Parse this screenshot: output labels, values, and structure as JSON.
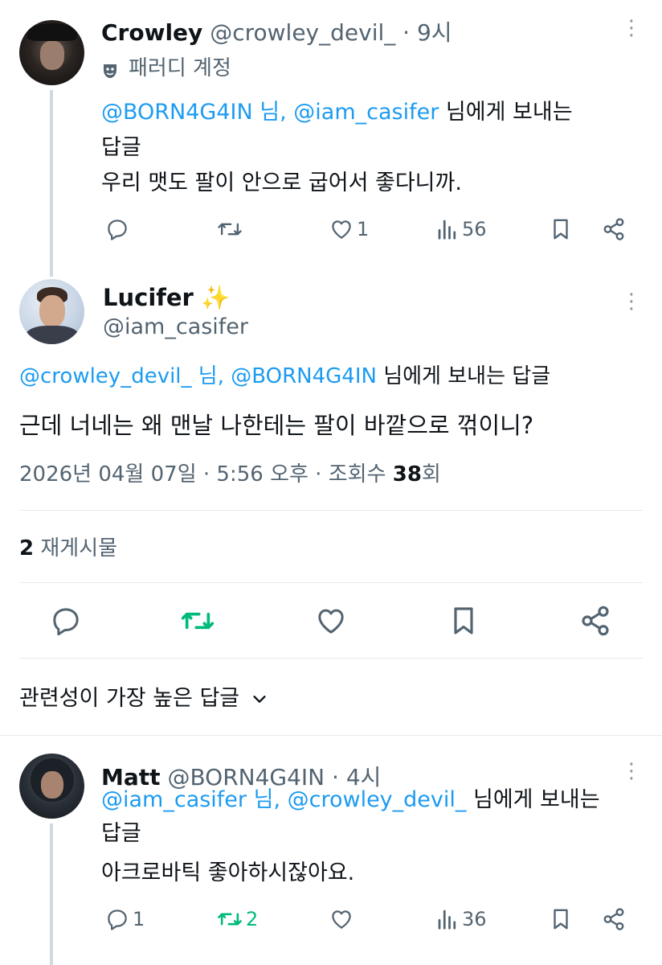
{
  "tweet1": {
    "display_name": "Crowley",
    "handle": "@crowley_devil_",
    "separator": "·",
    "time": "9시",
    "account_label": "패러디 계정",
    "reply_to_links": "@BORN4G4IN 님, @iam_casifer",
    "reply_to_suffix": "님에게 보내는",
    "reply_to_line2": "답글",
    "text": "우리 맷도 팔이 안으로 굽어서 좋다니까.",
    "likes": "1",
    "views": "56"
  },
  "main_tweet": {
    "display_name": "Lucifer",
    "name_emoji": "✨",
    "handle": "@iam_casifer",
    "reply_to_links": "@crowley_devil_ 님, @BORN4G4IN",
    "reply_to_suffix": "님에게 보내는 답글",
    "text": "근데 너네는 왜 맨날 나한테는 팔이 바깥으로 꺾이니?",
    "timestamp_prefix": "2026년 04월 07일 · 5:56 오후 · 조회수",
    "views": "38",
    "views_suffix": "회",
    "reposts_count": "2",
    "reposts_label": "재게시물"
  },
  "replies_filter": {
    "label": "관련성이 가장 높은 답글"
  },
  "tweet3": {
    "display_name": "Matt",
    "handle": "@BORN4G4IN",
    "separator": "·",
    "time": "4시",
    "reply_to_links": "@iam_casifer 님, @crowley_devil_",
    "reply_to_suffix": "님에게 보내는",
    "reply_to_line2": "답글",
    "text": "아크로바틱 좋아하시잖아요.",
    "replies": "1",
    "reposts": "2",
    "views": "36"
  },
  "colors": {
    "link": "#1d9bf0",
    "muted": "#536471",
    "repost_active": "#00ba7c",
    "text": "#0f1419"
  },
  "icons": [
    "reply-icon",
    "repost-icon",
    "like-icon",
    "views-icon",
    "bookmark-icon",
    "share-icon",
    "more-icon",
    "parody-mask-icon",
    "chevron-down-icon"
  ]
}
